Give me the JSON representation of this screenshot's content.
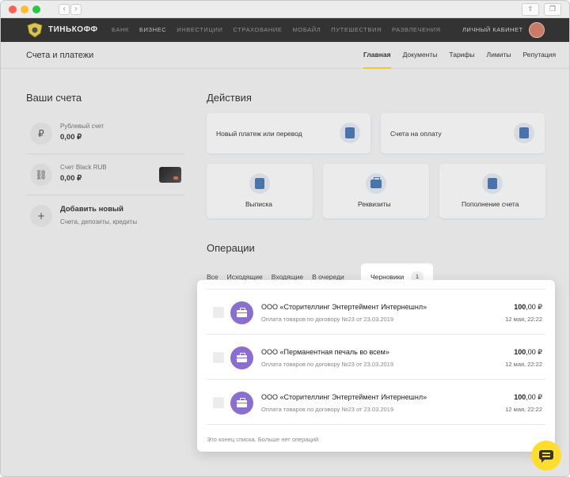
{
  "topnav": {
    "brand": "ТИНЬКОФФ",
    "links": [
      "БАНК",
      "БИЗНЕС",
      "ИНВЕСТИЦИИ",
      "СТРАХОВАНИЕ",
      "МОБАЙЛ",
      "ПУТЕШЕСТВИЯ",
      "РАЗВЛЕЧЕНИЯ"
    ],
    "cabinet": "ЛИЧНЫЙ КАБИНЕТ"
  },
  "subheader": {
    "title": "Счета и платежи",
    "tabs": [
      "Главная",
      "Документы",
      "Тарифы",
      "Лимиты",
      "Репутация"
    ]
  },
  "accounts": {
    "heading": "Ваши счета",
    "items": [
      {
        "name": "Рублевый счет",
        "value": "0,00 ₽",
        "icon": "ruble-icon"
      },
      {
        "name": "Счет Black RUB",
        "value": "0,00 ₽",
        "icon": "link-icon"
      }
    ],
    "add": {
      "title": "Добавить новый",
      "subtitle": "Счета, депозиты, кредиты"
    }
  },
  "actions": {
    "heading": "Действия",
    "new_payment": "Новый платеж или перевод",
    "invoices": "Счета на оплату",
    "statement": "Выписка",
    "requisites": "Реквизиты",
    "topup": "Пополнение счета"
  },
  "operations": {
    "heading": "Операции",
    "tabs": [
      "Все",
      "Исходящие",
      "Входящие",
      "В очереди"
    ],
    "drafts_tab": "Черновики",
    "drafts_count": "1",
    "rows": [
      {
        "title": "ООО «Сторителлинг Энтертеймент Интернешнл»",
        "desc": "Оплата товаров по договору №23 от 23.03.2019",
        "amount_int": "100",
        "amount_frac": ",00 ₽",
        "date": "12 мая, 22:22"
      },
      {
        "title": "ООО «Перманентная печаль во всем»",
        "desc": "Оплата товаров по договору №23 от 23.03.2019",
        "amount_int": "100",
        "amount_frac": ",00 ₽",
        "date": "12 мая, 22:22"
      },
      {
        "title": "ООО «Сторителлинг Энтертеймент Интернешнл»",
        "desc": "Оплата товаров по договору №23 от 23.03.2019",
        "amount_int": "100",
        "amount_frac": ",00 ₽",
        "date": "12 мая, 22:22"
      }
    ],
    "end_text": "Это конец списка. Больше нет операций"
  },
  "colors": {
    "accent": "#ffdd2d",
    "nav_bg": "#333333",
    "op_icon": "#8a6fd1"
  }
}
